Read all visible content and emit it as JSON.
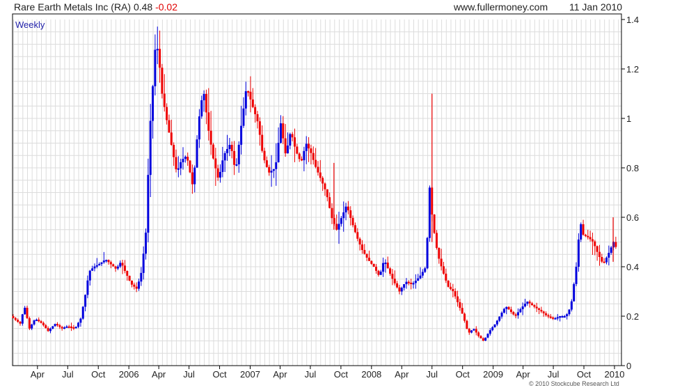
{
  "header": {
    "symbol_text": "Rare Earth Metals Inc (RA) 0.48",
    "change_text": "-0.02",
    "site": "www.fullermoney.com",
    "date": "11 Jan 2010"
  },
  "footer": {
    "copyright": "© 2010 Stockcube Research Ltd"
  },
  "colors": {
    "up": "#0000dd",
    "down": "#ee0000",
    "grid": "#dcdcdc",
    "axis": "#000000",
    "frame": "#000000"
  },
  "chart_data": {
    "type": "ohlc",
    "period_label": "Weekly",
    "title": "Rare Earth Metals Inc (RA) 0.48 -0.02",
    "xlabel": "",
    "ylabel": "",
    "ylim": [
      0,
      1.4
    ],
    "y_ticks": [
      0,
      0.2,
      0.4,
      0.6,
      0.8,
      1,
      1.2,
      1.4
    ],
    "y_tick_labels": [
      "0",
      "0.2",
      "0.4",
      "0.6",
      "0.8",
      "1",
      "1.2",
      "1.4"
    ],
    "y_axis_side": "right",
    "grid": true,
    "x_tick_labels": [
      {
        "label": "Apr",
        "date": "2005-04-01"
      },
      {
        "label": "Jul",
        "date": "2005-07-01"
      },
      {
        "label": "Oct",
        "date": "2005-10-01"
      },
      {
        "label": "2006",
        "date": "2006-01-01"
      },
      {
        "label": "Apr",
        "date": "2006-04-01"
      },
      {
        "label": "Jul",
        "date": "2006-07-01"
      },
      {
        "label": "Oct",
        "date": "2006-10-01"
      },
      {
        "label": "2007",
        "date": "2007-01-01"
      },
      {
        "label": "Apr",
        "date": "2007-04-01"
      },
      {
        "label": "Jul",
        "date": "2007-07-01"
      },
      {
        "label": "Oct",
        "date": "2007-10-01"
      },
      {
        "label": "2008",
        "date": "2008-01-01"
      },
      {
        "label": "Apr",
        "date": "2008-04-01"
      },
      {
        "label": "Jul",
        "date": "2008-07-01"
      },
      {
        "label": "Oct",
        "date": "2008-10-01"
      },
      {
        "label": "2009",
        "date": "2009-01-01"
      },
      {
        "label": "Apr",
        "date": "2009-04-01"
      },
      {
        "label": "Jul",
        "date": "2009-07-01"
      },
      {
        "label": "Oct",
        "date": "2009-10-01"
      },
      {
        "label": "2010",
        "date": "2010-01-01"
      }
    ],
    "x_start": "2005-01-16",
    "x_end": "2010-01-22",
    "series": [
      {
        "date": "2005-01-18",
        "price": 0.2
      },
      {
        "date": "2005-02-15",
        "price": 0.17
      },
      {
        "date": "2005-02-28",
        "price": 0.24
      },
      {
        "date": "2005-03-15",
        "price": 0.15
      },
      {
        "date": "2005-04-01",
        "price": 0.19
      },
      {
        "date": "2005-04-22",
        "price": 0.17
      },
      {
        "date": "2005-05-10",
        "price": 0.14
      },
      {
        "date": "2005-06-01",
        "price": 0.17
      },
      {
        "date": "2005-06-20",
        "price": 0.15
      },
      {
        "date": "2005-07-08",
        "price": 0.16
      },
      {
        "date": "2005-07-30",
        "price": 0.15
      },
      {
        "date": "2005-08-16",
        "price": 0.19
      },
      {
        "date": "2005-09-01",
        "price": 0.3
      },
      {
        "date": "2005-09-10",
        "price": 0.38
      },
      {
        "date": "2005-09-25",
        "price": 0.4
      },
      {
        "date": "2005-10-10",
        "price": 0.41
      },
      {
        "date": "2005-10-30",
        "price": 0.43
      },
      {
        "date": "2005-11-15",
        "price": 0.41
      },
      {
        "date": "2005-12-01",
        "price": 0.39
      },
      {
        "date": "2005-12-15",
        "price": 0.42
      },
      {
        "date": "2005-12-28",
        "price": 0.38
      },
      {
        "date": "2006-01-15",
        "price": 0.33
      },
      {
        "date": "2006-02-01",
        "price": 0.31
      },
      {
        "date": "2006-02-15",
        "price": 0.38
      },
      {
        "date": "2006-03-01",
        "price": 0.55
      },
      {
        "date": "2006-03-05",
        "price": 0.7
      },
      {
        "date": "2006-03-12",
        "price": 0.95
      },
      {
        "date": "2006-03-22",
        "price": 1.15
      },
      {
        "date": "2006-03-30",
        "price": 1.32
      },
      {
        "date": "2006-04-08",
        "price": 1.25
      },
      {
        "date": "2006-04-18",
        "price": 1.1
      },
      {
        "date": "2006-05-01",
        "price": 1.0
      },
      {
        "date": "2006-05-15",
        "price": 0.9
      },
      {
        "date": "2006-06-01",
        "price": 0.78
      },
      {
        "date": "2006-06-15",
        "price": 0.83
      },
      {
        "date": "2006-07-01",
        "price": 0.85
      },
      {
        "date": "2006-07-20",
        "price": 0.72
      },
      {
        "date": "2006-08-05",
        "price": 0.98
      },
      {
        "date": "2006-08-20",
        "price": 1.12
      },
      {
        "date": "2006-09-05",
        "price": 0.95
      },
      {
        "date": "2006-09-20",
        "price": 0.83
      },
      {
        "date": "2006-10-05",
        "price": 0.75
      },
      {
        "date": "2006-10-20",
        "price": 0.85
      },
      {
        "date": "2006-11-10",
        "price": 0.9
      },
      {
        "date": "2006-11-25",
        "price": 0.78
      },
      {
        "date": "2006-12-10",
        "price": 0.95
      },
      {
        "date": "2006-12-28",
        "price": 1.13
      },
      {
        "date": "2007-01-15",
        "price": 1.05
      },
      {
        "date": "2007-02-01",
        "price": 0.98
      },
      {
        "date": "2007-02-15",
        "price": 0.85
      },
      {
        "date": "2007-03-05",
        "price": 0.78
      },
      {
        "date": "2007-03-25",
        "price": 0.8
      },
      {
        "date": "2007-04-10",
        "price": 0.98
      },
      {
        "date": "2007-04-25",
        "price": 0.85
      },
      {
        "date": "2007-05-10",
        "price": 0.95
      },
      {
        "date": "2007-05-25",
        "price": 0.87
      },
      {
        "date": "2007-06-10",
        "price": 0.82
      },
      {
        "date": "2007-06-25",
        "price": 0.9
      },
      {
        "date": "2007-07-10",
        "price": 0.86
      },
      {
        "date": "2007-07-25",
        "price": 0.8
      },
      {
        "date": "2007-08-10",
        "price": 0.75
      },
      {
        "date": "2007-08-25",
        "price": 0.7
      },
      {
        "date": "2007-09-10",
        "price": 0.6
      },
      {
        "date": "2007-09-25",
        "price": 0.55
      },
      {
        "date": "2007-10-10",
        "price": 0.6
      },
      {
        "date": "2007-10-25",
        "price": 0.65
      },
      {
        "date": "2007-11-10",
        "price": 0.58
      },
      {
        "date": "2007-11-25",
        "price": 0.52
      },
      {
        "date": "2007-12-10",
        "price": 0.47
      },
      {
        "date": "2007-12-28",
        "price": 0.43
      },
      {
        "date": "2008-01-15",
        "price": 0.4
      },
      {
        "date": "2008-02-01",
        "price": 0.36
      },
      {
        "date": "2008-02-15",
        "price": 0.43
      },
      {
        "date": "2008-03-01",
        "price": 0.38
      },
      {
        "date": "2008-03-15",
        "price": 0.34
      },
      {
        "date": "2008-04-01",
        "price": 0.3
      },
      {
        "date": "2008-04-20",
        "price": 0.34
      },
      {
        "date": "2008-05-10",
        "price": 0.33
      },
      {
        "date": "2008-06-01",
        "price": 0.36
      },
      {
        "date": "2008-06-20",
        "price": 0.4
      },
      {
        "date": "2008-07-01",
        "price": 0.72
      },
      {
        "date": "2008-07-10",
        "price": 0.58
      },
      {
        "date": "2008-07-25",
        "price": 0.45
      },
      {
        "date": "2008-08-10",
        "price": 0.38
      },
      {
        "date": "2008-08-25",
        "price": 0.32
      },
      {
        "date": "2008-09-10",
        "price": 0.3
      },
      {
        "date": "2008-09-25",
        "price": 0.25
      },
      {
        "date": "2008-10-10",
        "price": 0.2
      },
      {
        "date": "2008-10-25",
        "price": 0.13
      },
      {
        "date": "2008-11-10",
        "price": 0.15
      },
      {
        "date": "2008-11-25",
        "price": 0.12
      },
      {
        "date": "2008-12-10",
        "price": 0.1
      },
      {
        "date": "2008-12-28",
        "price": 0.14
      },
      {
        "date": "2009-01-15",
        "price": 0.17
      },
      {
        "date": "2009-02-01",
        "price": 0.21
      },
      {
        "date": "2009-02-15",
        "price": 0.24
      },
      {
        "date": "2009-03-01",
        "price": 0.22
      },
      {
        "date": "2009-03-15",
        "price": 0.2
      },
      {
        "date": "2009-04-01",
        "price": 0.23
      },
      {
        "date": "2009-04-20",
        "price": 0.26
      },
      {
        "date": "2009-05-10",
        "price": 0.24
      },
      {
        "date": "2009-06-01",
        "price": 0.22
      },
      {
        "date": "2009-06-20",
        "price": 0.2
      },
      {
        "date": "2009-07-10",
        "price": 0.19
      },
      {
        "date": "2009-07-28",
        "price": 0.2
      },
      {
        "date": "2009-08-15",
        "price": 0.2
      },
      {
        "date": "2009-08-30",
        "price": 0.24
      },
      {
        "date": "2009-09-10",
        "price": 0.35
      },
      {
        "date": "2009-09-20",
        "price": 0.45
      },
      {
        "date": "2009-09-25",
        "price": 0.6
      },
      {
        "date": "2009-10-05",
        "price": 0.53
      },
      {
        "date": "2009-10-20",
        "price": 0.52
      },
      {
        "date": "2009-11-05",
        "price": 0.5
      },
      {
        "date": "2009-11-20",
        "price": 0.45
      },
      {
        "date": "2009-12-05",
        "price": 0.41
      },
      {
        "date": "2009-12-20",
        "price": 0.45
      },
      {
        "date": "2010-01-05",
        "price": 0.5
      },
      {
        "date": "2010-01-11",
        "price": 0.48
      }
    ],
    "spikes": [
      {
        "date": "2008-07-01",
        "high": 1.1,
        "low": 0.5
      },
      {
        "date": "2007-09-10",
        "high": 0.82,
        "low": 0.55
      },
      {
        "date": "2009-12-28",
        "high": 0.6,
        "low": 0.42
      }
    ]
  }
}
